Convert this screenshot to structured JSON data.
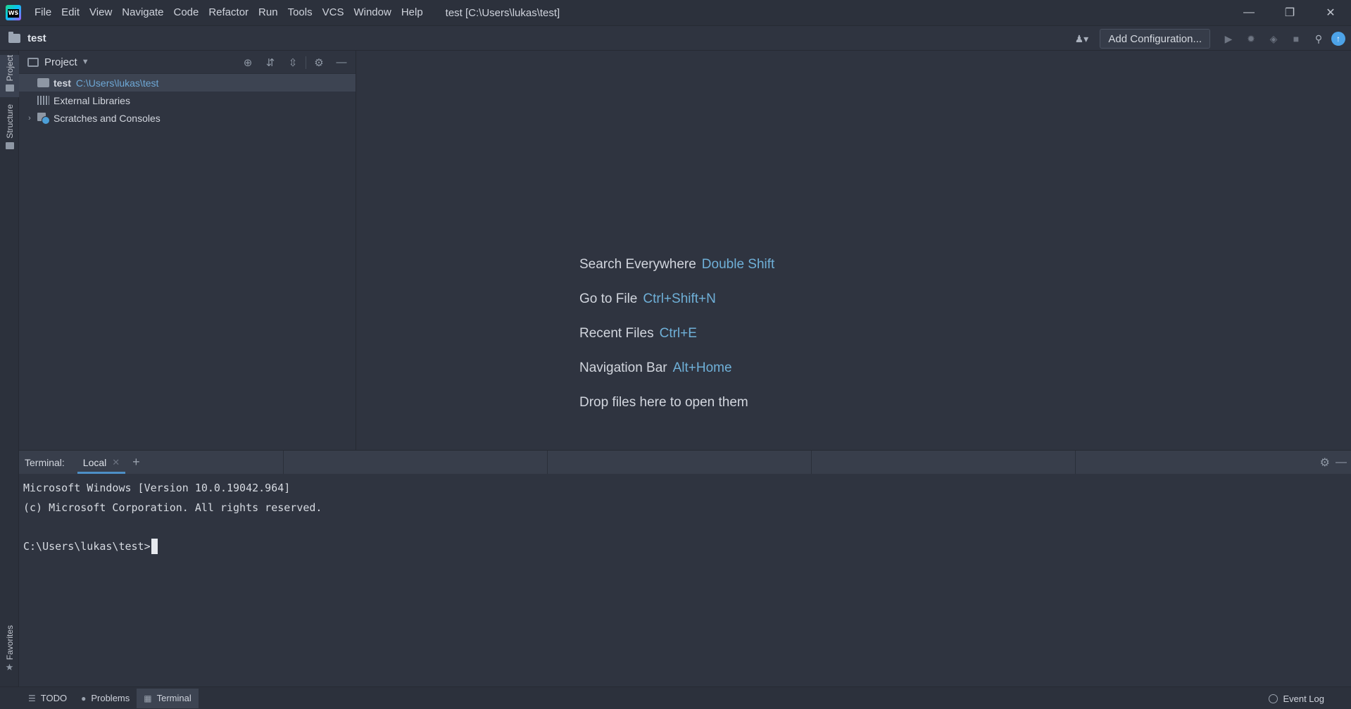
{
  "window": {
    "title": "test [C:\\Users\\lukas\\test]",
    "menu": [
      "File",
      "Edit",
      "View",
      "Navigate",
      "Code",
      "Refactor",
      "Run",
      "Tools",
      "VCS",
      "Window",
      "Help"
    ],
    "controls": [
      "minimize",
      "restore",
      "close"
    ]
  },
  "navbar": {
    "project_name": "test",
    "add_config_label": "Add Configuration..."
  },
  "left_strip": {
    "tabs": [
      "Project",
      "Structure"
    ],
    "favorites": "Favorites"
  },
  "project_panel": {
    "title": "Project",
    "tree": [
      {
        "name": "test",
        "path": "C:\\Users\\lukas\\test",
        "expanded": true,
        "selected": true
      },
      {
        "name": "External Libraries"
      },
      {
        "name": "Scratches and Consoles",
        "collapsed": true
      }
    ]
  },
  "editor": {
    "hints": [
      {
        "label": "Search Everywhere",
        "shortcut": "Double Shift"
      },
      {
        "label": "Go to File",
        "shortcut": "Ctrl+Shift+N"
      },
      {
        "label": "Recent Files",
        "shortcut": "Ctrl+E"
      },
      {
        "label": "Navigation Bar",
        "shortcut": "Alt+Home"
      },
      {
        "label": "Drop files here to open them",
        "shortcut": ""
      }
    ]
  },
  "terminal": {
    "label": "Terminal:",
    "tab": "Local",
    "lines": [
      "Microsoft Windows [Version 10.0.19042.964]",
      "(c) Microsoft Corporation. All rights reserved.",
      "",
      "C:\\Users\\lukas\\test>"
    ]
  },
  "statusbar": {
    "tabs": [
      {
        "label": "TODO",
        "icon": "list-icon",
        "active": false
      },
      {
        "label": "Problems",
        "icon": "info-icon",
        "active": false
      },
      {
        "label": "Terminal",
        "icon": "terminal-icon",
        "active": true
      }
    ],
    "event_log": "Event Log"
  },
  "colors": {
    "background": "#2f3440",
    "accent": "#4d8fc7",
    "shortcut": "#6fb0d8"
  }
}
